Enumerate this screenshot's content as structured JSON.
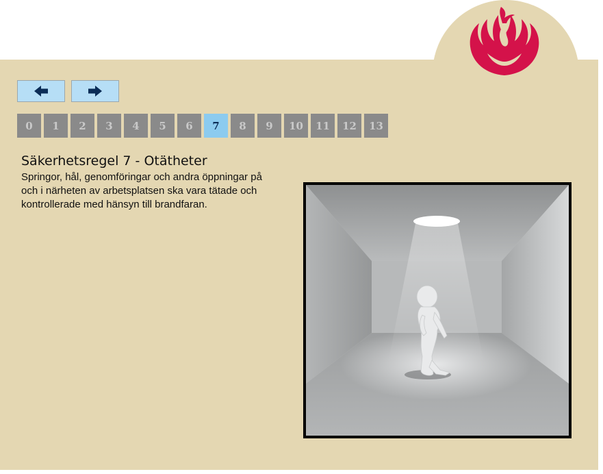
{
  "navigation": {
    "prev_label": "Föregående",
    "next_label": "Nästa",
    "pages": [
      "0",
      "1",
      "2",
      "3",
      "4",
      "5",
      "6",
      "7",
      "8",
      "9",
      "10",
      "11",
      "12",
      "13"
    ],
    "active_page": "7"
  },
  "slide": {
    "title": "Säkerhetsregel 7 - Otätheter",
    "body": "Springor, hål, genomföringar och andra öppningar på och i närheten av arbetsplatsen ska vara tätade och kontrollerade med hänsyn till brandfaran."
  },
  "colors": {
    "panel": "#e4d7b2",
    "nav_button": "#b6def6",
    "page_button": "#8a8a8a",
    "page_button_active": "#8ccbef",
    "logo": "#d4124a"
  },
  "icons": {
    "logo": "phoenix-logo-icon",
    "prev": "arrow-left-icon",
    "next": "arrow-right-icon",
    "illustration": "empty-room-figure-image"
  }
}
